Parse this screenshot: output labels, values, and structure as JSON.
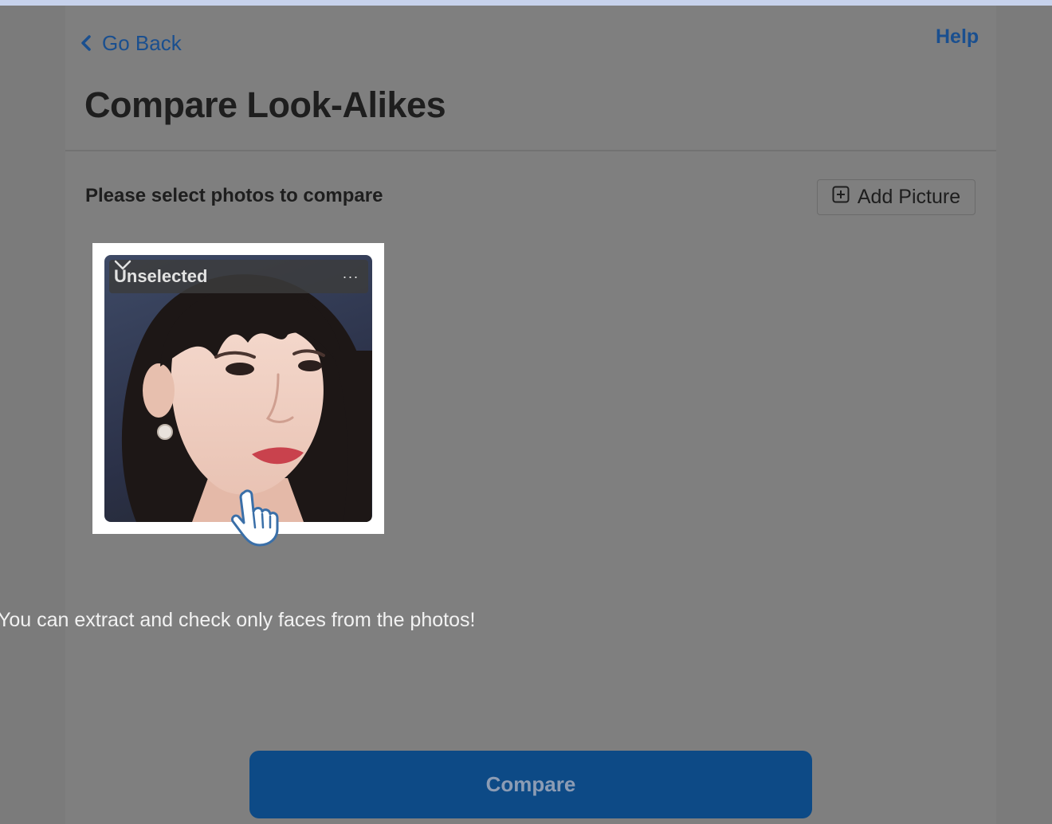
{
  "nav": {
    "back_label": "Go Back",
    "back_icon": "chevron-left-icon",
    "help_label": "Help"
  },
  "page": {
    "title": "Compare Look-Alikes"
  },
  "selection": {
    "prompt": "Please select photos to compare",
    "add_picture_label": "Add Picture",
    "add_picture_icon": "plus-square-icon"
  },
  "photos": [
    {
      "status_label": "Unselected",
      "dropdown_icon": "chevron-down-icon",
      "menu_label": "···"
    }
  ],
  "hint": "You can extract and check only faces from the photos!",
  "compare_label": "Compare",
  "colors": {
    "accent": "#1a4f8f",
    "primary_button": "#0d4a86",
    "overlay": "#7f7f7f"
  }
}
